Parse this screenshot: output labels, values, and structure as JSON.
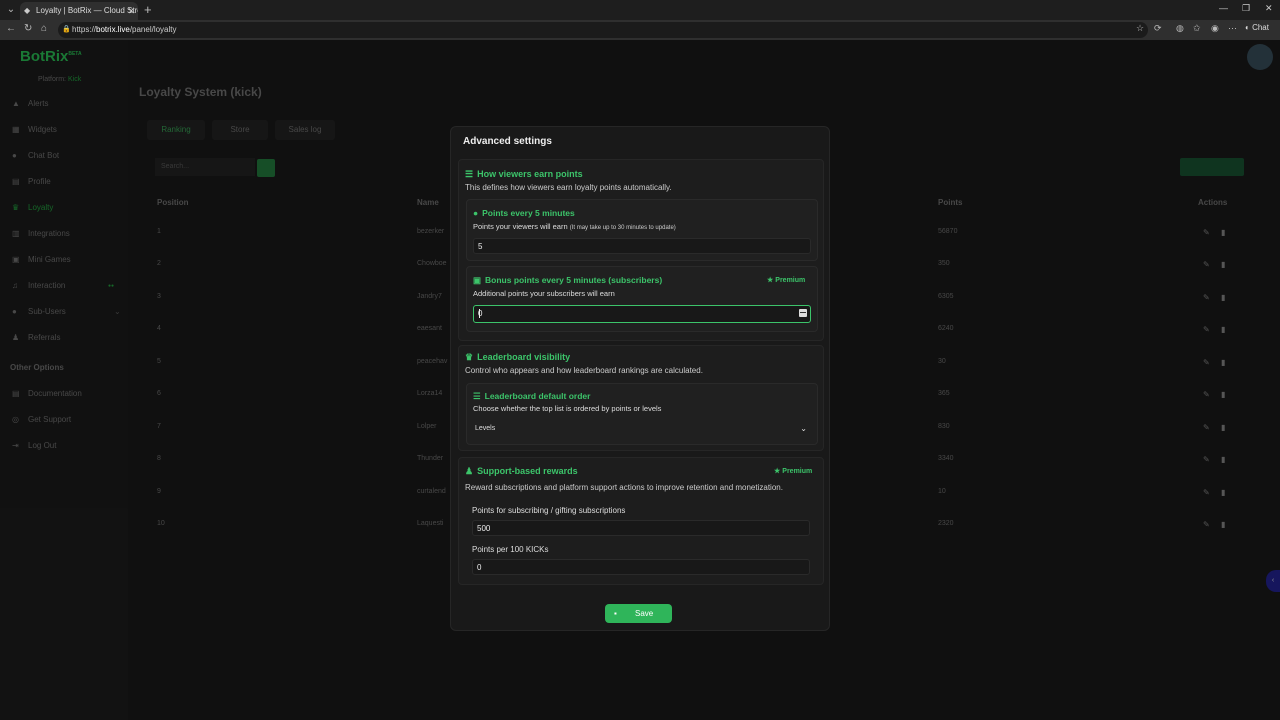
{
  "browser": {
    "tab_title": "Loyalty | BotRix — Cloud Streamin...",
    "url_host": "botrix.live",
    "url_prefix": "https://",
    "url_path": "/panel/loyalty",
    "chat_label": "Chat"
  },
  "sidebar": {
    "logo": "BotRix",
    "logo_sup": "BETA",
    "platform_label": "Platform:",
    "platform_value": "Kick",
    "items": [
      {
        "label": "Alerts"
      },
      {
        "label": "Widgets"
      },
      {
        "label": "Chat Bot"
      },
      {
        "label": "Profile"
      },
      {
        "label": "Loyalty"
      },
      {
        "label": "Integrations"
      },
      {
        "label": "Mini Games"
      },
      {
        "label": "Interaction"
      },
      {
        "label": "Sub-Users"
      },
      {
        "label": "Referrals"
      }
    ],
    "other_heading": "Other Options",
    "other_items": [
      {
        "label": "Documentation"
      },
      {
        "label": "Get Support"
      },
      {
        "label": "Log Out"
      }
    ]
  },
  "page": {
    "title": "Loyalty System (kick)",
    "tabs": [
      "Ranking",
      "Store",
      "Sales log"
    ],
    "search_placeholder": "Search...",
    "columns": [
      "Position",
      "Name",
      "Points",
      "Actions"
    ],
    "rows": [
      {
        "pos": "1",
        "name": "bezerker",
        "points": "56870"
      },
      {
        "pos": "2",
        "name": "Chowboe",
        "points": "350"
      },
      {
        "pos": "3",
        "name": "Jandry7",
        "points": "6305"
      },
      {
        "pos": "4",
        "name": "eaesant",
        "points": "6240"
      },
      {
        "pos": "5",
        "name": "peacehav",
        "points": "30"
      },
      {
        "pos": "6",
        "name": "Lorza14",
        "points": "365"
      },
      {
        "pos": "7",
        "name": "Lolper",
        "points": "830"
      },
      {
        "pos": "8",
        "name": "Thunder",
        "points": "3340"
      },
      {
        "pos": "9",
        "name": "curtalend",
        "points": "10"
      },
      {
        "pos": "10",
        "name": "Laquesti",
        "points": "2320"
      }
    ]
  },
  "modal": {
    "title": "Advanced settings",
    "earn": {
      "heading": "How viewers earn points",
      "description": "This defines how viewers earn loyalty points automatically.",
      "points_every": {
        "heading": "Points every 5 minutes",
        "description": "Points your viewers will earn",
        "note": "(It may take up to 30 minutes to update)",
        "value": "5"
      },
      "bonus": {
        "heading": "Bonus points every 5 minutes (subscribers)",
        "premium": "Premium",
        "description": "Additional points your subscribers will earn",
        "value": "0"
      }
    },
    "leaderboard": {
      "heading": "Leaderboard visibility",
      "description": "Control who appears and how leaderboard rankings are calculated.",
      "order": {
        "heading": "Leaderboard default order",
        "description": "Choose whether the top list is ordered by points or levels",
        "selected": "Levels"
      }
    },
    "support": {
      "heading": "Support-based rewards",
      "premium": "Premium",
      "description": "Reward subscriptions and platform support actions to improve retention and monetization.",
      "subs_label": "Points for subscribing / gifting subscriptions",
      "subs_value": "500",
      "kicks_label": "Points per 100 KICKs",
      "kicks_value": "0"
    },
    "save_label": "Save"
  }
}
